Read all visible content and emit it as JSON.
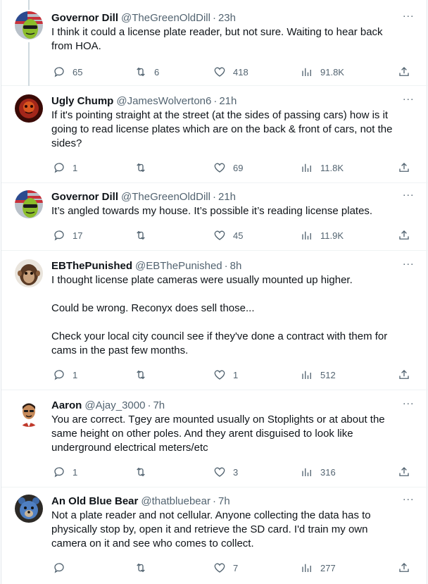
{
  "tweets": [
    {
      "name": "Governor Dill",
      "handle": "@TheGreenOldDill",
      "time": "23h",
      "text": "I think it could a license plate reader, but not sure. Waiting to hear back\nfrom HOA.",
      "replies": "65",
      "retweets": "6",
      "likes": "418",
      "views": "91.8K",
      "avatar": "green-pickle-with-sunglasses-flag"
    },
    {
      "name": "Ugly Chump",
      "handle": "@JamesWolverton6",
      "time": "21h",
      "text": "If it's pointing straight at the street (at the sides of passing cars) how is it\ngoing to read license plates which are on the back & front of cars, not the\nsides?",
      "replies": "1",
      "retweets": "",
      "likes": "69",
      "views": "11.8K",
      "avatar": "red-dark-portrait"
    },
    {
      "name": "Governor Dill",
      "handle": "@TheGreenOldDill",
      "time": "21h",
      "text": "It’s angled towards my house. It’s possible it’s reading license plates.",
      "replies": "17",
      "retweets": "",
      "likes": "45",
      "views": "11.9K",
      "avatar": "green-pickle-with-sunglasses-flag"
    },
    {
      "name": "EBThePunished",
      "handle": "@EBThePunished",
      "time": "8h",
      "text": "I thought license plate cameras were usually mounted up higher.\n\nCould be wrong. Reconyx does sell those...\n\nCheck your local city council see if they've done a contract with them for\ncams in the past few months.",
      "replies": "1",
      "retweets": "",
      "likes": "1",
      "views": "512",
      "avatar": "monkey-face"
    },
    {
      "name": "Aaron",
      "handle": "@Ajay_3000",
      "time": "7h",
      "text": "You are correct. Tgey are mounted usually on Stoplights or at about the\nsame height on other poles. And they arent disguised to look like\nunderground electrical meters/etc",
      "replies": "1",
      "retweets": "",
      "likes": "3",
      "views": "316",
      "avatar": "cartoon-man-emoji"
    },
    {
      "name": "An Old Blue Bear",
      "handle": "@thatbluebear",
      "time": "7h",
      "text": "Not a plate reader and not cellular. Anyone collecting the data has to\nphysically stop by, open it and retrieve the SD card. I'd train my own\ncamera on it and see who comes to collect.",
      "replies": "",
      "retweets": "",
      "likes": "7",
      "views": "277",
      "avatar": "blue-bear-portrait"
    }
  ],
  "more_glyph": "···",
  "separator": "·",
  "colors": {
    "text_primary": "#0f1419",
    "text_secondary": "#536471",
    "thread_line": "#cfd9de",
    "divider": "#eff3f4"
  }
}
